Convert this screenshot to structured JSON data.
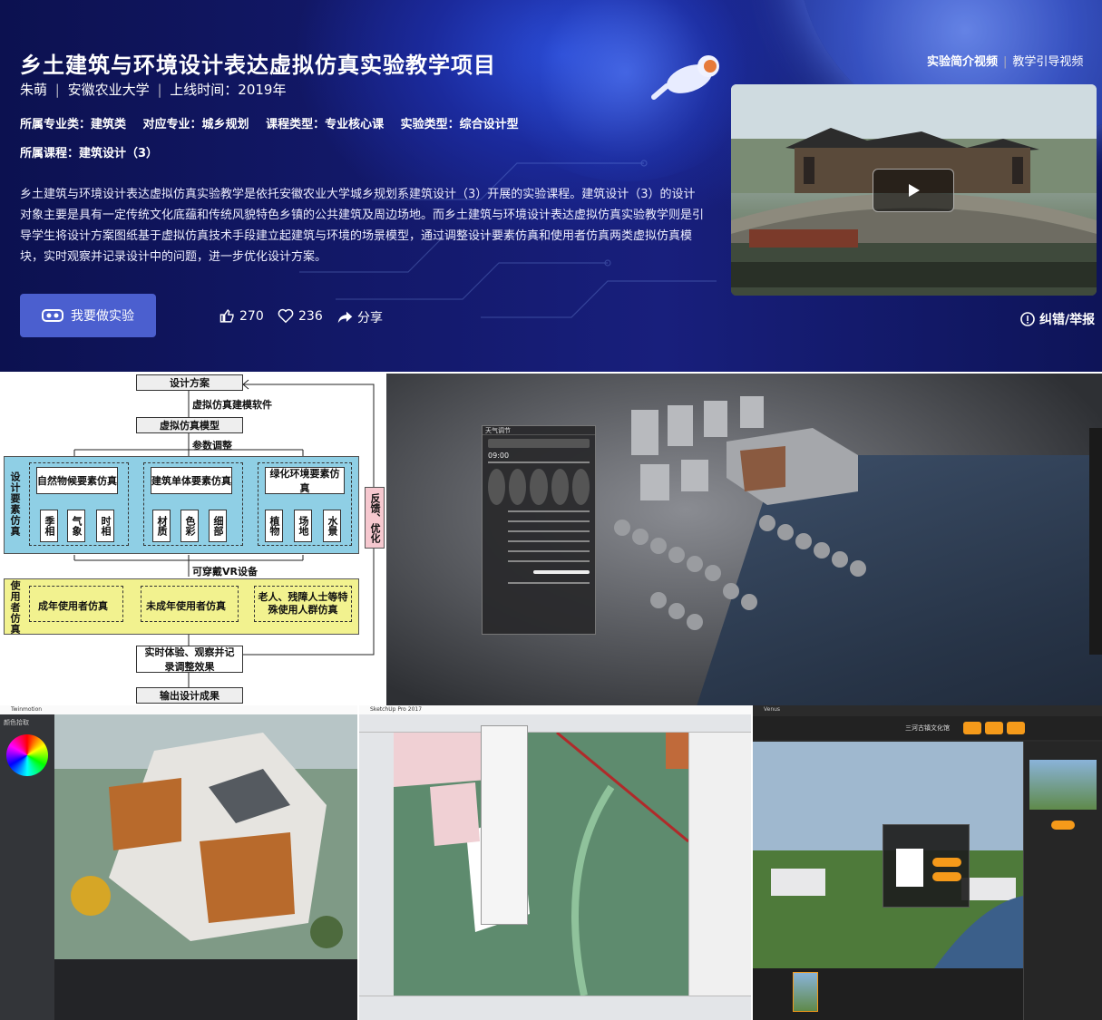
{
  "header": {
    "title": "乡土建筑与环境设计表达虚拟仿真实验教学项目",
    "author": "朱萌",
    "school": "安徽农业大学",
    "launch": "上线时间：2019年",
    "major_category": "所属专业类：建筑类",
    "major": "对应专业：城乡规划",
    "course_type": "课程类型：专业核心课",
    "exp_type": "实验类型：综合设计型",
    "course": "所属课程：建筑设计（3）",
    "description": "乡土建筑与环境设计表达虚拟仿真实验教学是依托安徽农业大学城乡规划系建筑设计（3）开展的实验课程。建筑设计（3）的设计对象主要是具有一定传统文化底蕴和传统风貌特色乡镇的公共建筑及周边场地。而乡土建筑与环境设计表达虚拟仿真实验教学则是引导学生将设计方案图纸基于虚拟仿真技术手段建立起建筑与环境的场景模型，通过调整设计要素仿真和使用者仿真两类虚拟仿真模块，实时观察并记录设计中的问题，进一步优化设计方案。",
    "experiment_button": "我要做实验",
    "likes": "270",
    "favorites": "236",
    "share": "分享",
    "video_tab_1": "实验简介视频",
    "video_tab_2": "教学引导视频",
    "report": "纠错/举报"
  },
  "flowchart": {
    "design_plan": "设计方案",
    "modeling_software": "虚拟仿真建模软件",
    "sim_model": "虚拟仿真模型",
    "param_adjust": "参数调整",
    "design_element_sim": "设计要素仿真",
    "natural_climate": "自然物候要素仿真",
    "building_single": "建筑单体要素仿真",
    "greening_env": "绿化环境要素仿真",
    "season": "季相",
    "weather": "气象",
    "time_phase": "时相",
    "material": "材质",
    "color": "色彩",
    "detail": "细部",
    "plant": "植物",
    "site": "场地",
    "waterscape": "水景",
    "feedback": "反馈、优化",
    "vr_device": "可穿戴VR设备",
    "user_sim": "使用者仿真",
    "adult_user": "成年使用者仿真",
    "minor_user": "未成年使用者仿真",
    "special_user": "老人、残障人士等特殊使用人群仿真",
    "realtime": "实时体验、观察并记录调整效果",
    "output": "输出设计成果"
  },
  "scene": {
    "panel_title": "天气调节",
    "time_display": "09:00"
  },
  "apps": {
    "app1_title": "Twinmotion",
    "app1_panel": "颜色拾取",
    "app2_title": "SketchUp Pro 2017",
    "app3_title": "Venus",
    "app3_header": "三河古镇文化馆"
  },
  "colors": {
    "banner_dark": "#0c1150",
    "button": "#4b5fcf",
    "flow_blue": "#8fcfe5",
    "flow_yellow": "#f2f28f",
    "flow_pink": "#f6c8cf",
    "venus_orange": "#f59a1a"
  }
}
